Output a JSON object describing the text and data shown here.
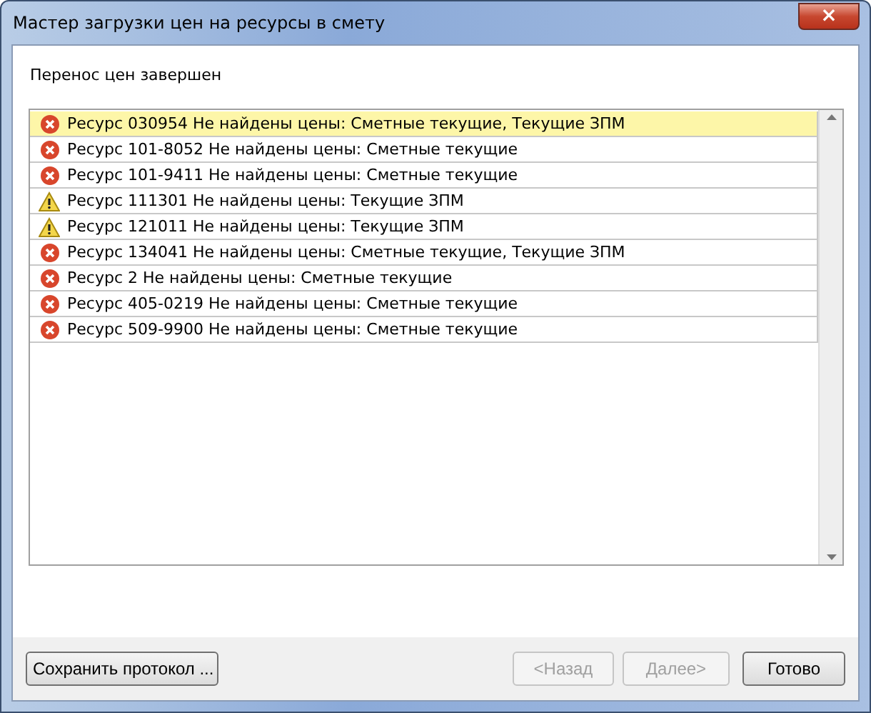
{
  "window": {
    "title": "Мастер загрузки цен на ресурсы в смету",
    "close": "×"
  },
  "status": "Перенос цен завершен",
  "log": [
    {
      "kind": "error",
      "text": "Ресурс 030954 Не найдены цены: Сметные текущие, Текущие ЗПМ",
      "selected": true
    },
    {
      "kind": "error",
      "text": "Ресурс 101-8052 Не найдены цены: Сметные текущие",
      "selected": false
    },
    {
      "kind": "error",
      "text": "Ресурс 101-9411 Не найдены цены: Сметные текущие",
      "selected": false
    },
    {
      "kind": "warning",
      "text": "Ресурс 111301 Не найдены цены: Текущие ЗПМ",
      "selected": false
    },
    {
      "kind": "warning",
      "text": "Ресурс 121011 Не найдены цены: Текущие ЗПМ",
      "selected": false
    },
    {
      "kind": "error",
      "text": "Ресурс 134041 Не найдены цены: Сметные текущие, Текущие ЗПМ",
      "selected": false
    },
    {
      "kind": "error",
      "text": "Ресурс 2 Не найдены цены: Сметные текущие",
      "selected": false
    },
    {
      "kind": "error",
      "text": "Ресурс 405-0219 Не найдены цены: Сметные текущие",
      "selected": false
    },
    {
      "kind": "error",
      "text": "Ресурс 509-9900 Не найдены цены: Сметные текущие",
      "selected": false
    }
  ],
  "buttons": [
    {
      "label": "Сохранить протокол ...",
      "disabled": false
    },
    {
      "label": "<Назад",
      "disabled": true
    },
    {
      "label": "Далее>",
      "disabled": true
    },
    {
      "label": "Готово",
      "disabled": false
    }
  ]
}
